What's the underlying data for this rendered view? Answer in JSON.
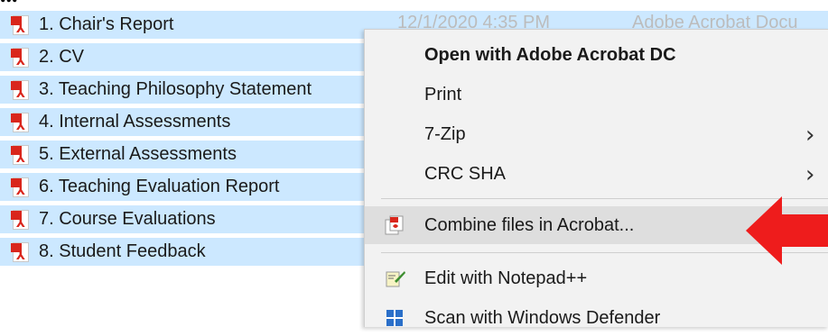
{
  "top_fragment": "...",
  "files": [
    {
      "name": "1. Chair's Report",
      "date": "12/1/2020 4:35 PM",
      "type": "Adobe Acrobat Docu"
    },
    {
      "name": "2. CV"
    },
    {
      "name": "3. Teaching Philosophy Statement"
    },
    {
      "name": "4. Internal Assessments"
    },
    {
      "name": "5. External Assessments"
    },
    {
      "name": "6. Teaching Evaluation Report"
    },
    {
      "name": "7. Course Evaluations"
    },
    {
      "name": "8. Student Feedback"
    }
  ],
  "context_menu": {
    "items": [
      {
        "label": "Open with Adobe Acrobat DC",
        "bold": true
      },
      {
        "label": "Print"
      },
      {
        "label": "7-Zip",
        "submenu": true
      },
      {
        "label": "CRC SHA",
        "submenu": true
      },
      {
        "label": "Combine files in Acrobat...",
        "icon": "acrobat-combine-icon",
        "highlighted": true
      },
      {
        "label": "Edit with Notepad++",
        "icon": "notepad-plus-plus-icon"
      },
      {
        "label": "Scan with Windows Defender",
        "icon": "windows-defender-icon"
      }
    ]
  },
  "colors": {
    "selection": "#cce8ff",
    "menu_bg": "#f2f2f2",
    "menu_highlight": "#dedede",
    "arrow": "#ee1c1c",
    "pdf_red": "#d9261c"
  }
}
